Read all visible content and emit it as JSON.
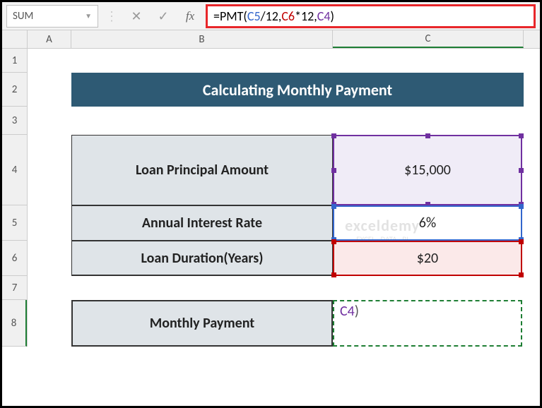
{
  "namebox": "SUM",
  "formula": {
    "prefix": "=PMT(",
    "ref1": "C5",
    "op1": "/12,",
    "ref2": "C6",
    "op2": "*12,",
    "ref3": "C4",
    "suffix": ")"
  },
  "columns": {
    "a": "A",
    "b": "B",
    "c": "C"
  },
  "rows": {
    "r1": "1",
    "r2": "2",
    "r3": "3",
    "r4": "4",
    "r5": "5",
    "r6": "6",
    "r7": "7",
    "r8": "8"
  },
  "title": "Calculating Monthly Payment",
  "labels": {
    "b4": "Loan Principal Amount",
    "b5": "Annual Interest Rate",
    "b6": "Loan Duration(Years)",
    "b8": "Monthly Payment"
  },
  "values": {
    "c4": "$15,000",
    "c5": "6%",
    "c6": "$20"
  },
  "editing": {
    "line1_hidden": "",
    "ref": "C4",
    "close": ")"
  },
  "watermark": {
    "brand": "exceldemy",
    "tagline": "EXCEL · DATA · BI"
  }
}
